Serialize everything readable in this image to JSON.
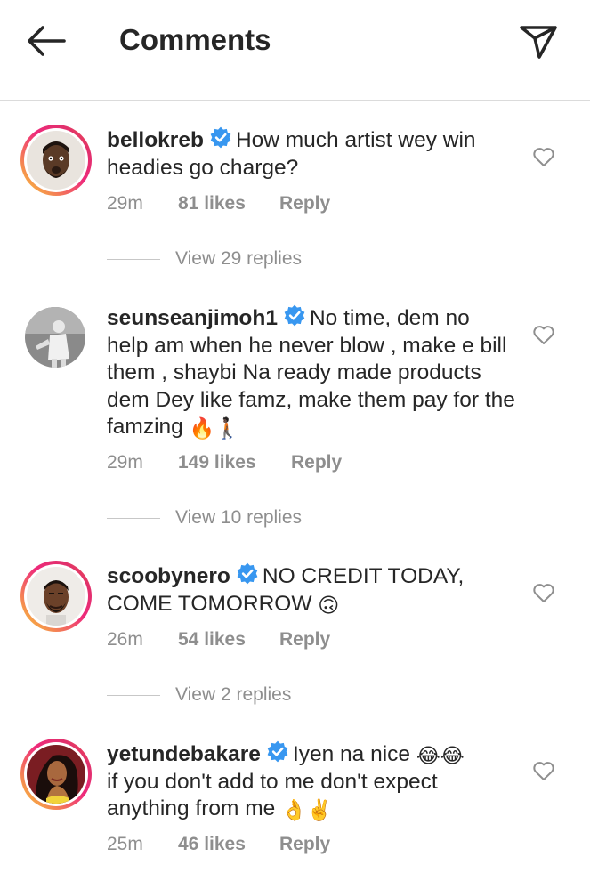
{
  "header": {
    "title": "Comments",
    "back_icon": "arrow-left-icon",
    "send_icon": "paper-plane-icon"
  },
  "colors": {
    "verified": "#3897f0",
    "meta_text": "#8e8e8e",
    "primary_text": "#262626"
  },
  "comments": [
    {
      "username": "bellokreb",
      "verified": true,
      "text": "How much artist wey win headies go charge?",
      "emoji": "",
      "time": "29m",
      "likes": "81 likes",
      "reply": "Reply",
      "view_replies": "View 29 replies"
    },
    {
      "username": "seunseanjimoh1",
      "verified": true,
      "text": "No time, dem no help am when he never blow , make e bill them , shaybi Na ready made products  dem Dey like famz, make them pay for the famzing",
      "emoji": "🔥🚶🏿",
      "time": "29m",
      "likes": "149 likes",
      "reply": "Reply",
      "view_replies": "View 10 replies"
    },
    {
      "username": "scoobynero",
      "verified": true,
      "text": "NO CREDIT TODAY, COME TOMORROW",
      "emoji": "🙃",
      "time": "26m",
      "likes": "54 likes",
      "reply": "Reply",
      "view_replies": "View 2 replies"
    },
    {
      "username": "yetundebakare",
      "verified": true,
      "text_line1": "Iyen na nice",
      "emoji_line1": "😂😂",
      "text_line2": "if you don't add to me don't expect anything from me",
      "emoji_line2": "👌✌️",
      "time": "25m",
      "likes": "46 likes",
      "reply": "Reply"
    }
  ]
}
